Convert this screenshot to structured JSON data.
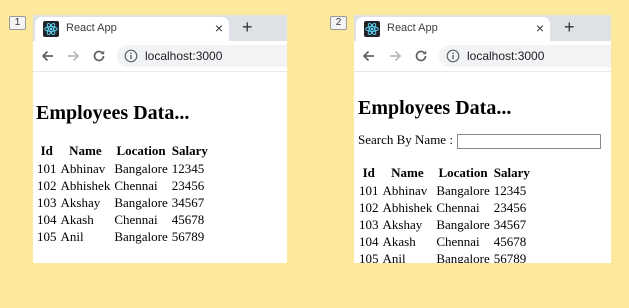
{
  "steps": [
    "1",
    "2"
  ],
  "browser": {
    "tab_title": "React App",
    "tab_close": "×",
    "new_tab": "+",
    "url": "localhost:3000"
  },
  "left": {
    "heading": "Employees Data..."
  },
  "right": {
    "heading": "Employees Data...",
    "search_label": "Search By Name :",
    "search_value": ""
  },
  "table": {
    "headers": [
      "Id",
      "Name",
      "Location",
      "Salary"
    ],
    "rows": [
      [
        "101",
        "Abhinav",
        "Bangalore",
        "12345"
      ],
      [
        "102",
        "Abhishek",
        "Chennai",
        "23456"
      ],
      [
        "103",
        "Akshay",
        "Bangalore",
        "34567"
      ],
      [
        "104",
        "Akash",
        "Chennai",
        "45678"
      ],
      [
        "105",
        "Anil",
        "Bangalore",
        "56789"
      ]
    ]
  },
  "icons": [
    "react-logo-icon",
    "close-icon",
    "plus-icon",
    "back-arrow-icon",
    "forward-arrow-icon",
    "reload-icon",
    "info-icon"
  ],
  "colors": {
    "page_background": "#fce99b",
    "tab_strip": "#dee1e6",
    "react_blue": "#61dafb"
  }
}
